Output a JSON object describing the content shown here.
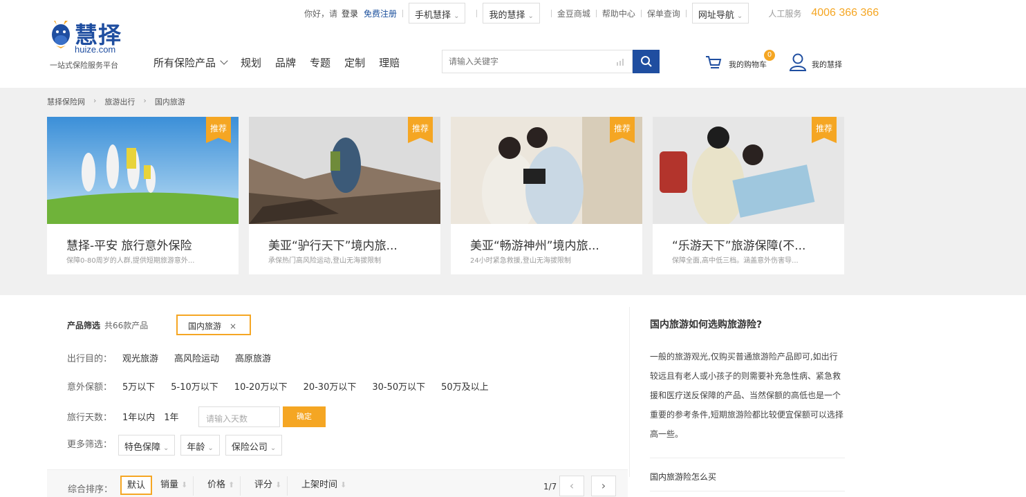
{
  "topbar": {
    "greeting": "你好，请",
    "login": "登录",
    "register": "免费注册",
    "links": [
      "手机慧择",
      "我的慧择",
      "金豆商城",
      "帮助中心",
      "保单查询",
      "网址导航",
      "人工服务"
    ],
    "hotline": "4006 366 366"
  },
  "header": {
    "logo_cn": "慧择",
    "logo_en": "huize.com",
    "slogan": "一站式保险服务平台",
    "nav": [
      "所有保险产品",
      "规划",
      "品牌",
      "专题",
      "定制",
      "理赔"
    ],
    "search_placeholder": "请输入关键字",
    "cart_label": "我的购物车",
    "cart_count": "0",
    "mine_label": "我的慧择"
  },
  "breadcrumb": [
    "慧择保险网",
    "旅游出行",
    "国内旅游"
  ],
  "cards": [
    {
      "tag": "推荐",
      "title": "慧择-平安 旅行意外保险",
      "desc": "保障0-80周岁的人群,提供短期旅游意外..."
    },
    {
      "tag": "推荐",
      "title": "美亚“驴行天下”境内旅...",
      "desc": "承保热门高风险运动,登山无海拔限制"
    },
    {
      "tag": "推荐",
      "title": "美亚“畅游神州”境内旅...",
      "desc": "24小时紧急救援,登山无海拔限制"
    },
    {
      "tag": "推荐",
      "title": "“乐游天下”旅游保障(不...",
      "desc": "保障全面,高中低三档。涵盖意外伤害导..."
    }
  ],
  "filter": {
    "title": "产品筛选",
    "count": "共66款产品",
    "chip": "国内旅游",
    "rows": {
      "purpose": {
        "label": "出行目的：",
        "options": [
          "观光旅游",
          "高风险运动",
          "高原旅游"
        ]
      },
      "coverage": {
        "label": "意外保额：",
        "options": [
          "5万以下",
          "5-10万以下",
          "10-20万以下",
          "20-30万以下",
          "30-50万以下",
          "50万及以上"
        ]
      },
      "days": {
        "label": "旅行天数：",
        "options": [
          "1年以内",
          "1年"
        ],
        "placeholder": "请输入天数",
        "confirm": "确定"
      },
      "more": {
        "label": "更多筛选：",
        "options": [
          "特色保障",
          "年龄",
          "保险公司"
        ]
      }
    }
  },
  "sort": {
    "label": "综合排序：",
    "items": [
      "默认",
      "销量",
      "价格",
      "评分",
      "上架时间"
    ],
    "page": "1/7"
  },
  "sidebar": {
    "heading": "国内旅游如何选购旅游险?",
    "body": "一般的旅游观光,仅购买普通旅游险产品即可,如出行较远且有老人或小孩子的则需要补充急性病、紧急救援和医疗送反保障的产品、当然保额的高低也是一个重要的参考条件,短期旅游险都比较便宜保额可以选择高一些。",
    "link": "国内旅游险怎么买"
  },
  "colors": {
    "brand_blue": "#1f4ea0",
    "accent_orange": "#f5a623",
    "band_gray": "#f0f0f0"
  }
}
